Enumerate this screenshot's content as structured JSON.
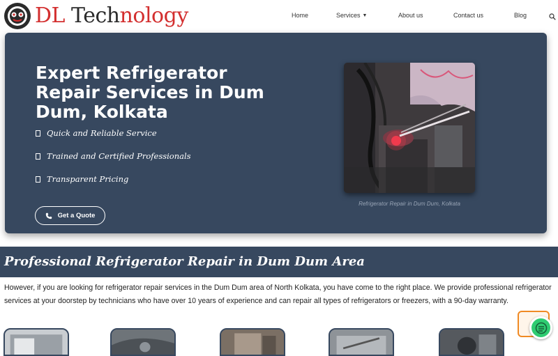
{
  "header": {
    "brand": {
      "part1": "DL",
      "part2": " Tech",
      "part3": "nology"
    },
    "nav": {
      "home": "Home",
      "services": "Services",
      "about": "About us",
      "contact": "Contact us",
      "blog": "Blog"
    },
    "icons": {
      "logo": "logo-emblem",
      "services_dropdown": "chevron-down-icon",
      "search": "search-icon"
    }
  },
  "hero": {
    "title": "Expert Refrigerator Repair Services in Dum Dum, Kolkata",
    "features": [
      "Quick and Reliable Service",
      "Trained and Certified Professionals",
      "Transparent Pricing"
    ],
    "cta_label": "Get a Quote",
    "cta_icon": "phone-icon",
    "image_caption": "Refrigerator Repair in Dum Dum, Kolkata"
  },
  "section": {
    "title": "Professional Refrigerator Repair in Dum Dum Area",
    "intro": "However, if you are looking for refrigerator repair services in the Dum Dum area of North Kolkata, you have come to the right place. We provide professional refrigerator services at your doorstep by technicians who have over 10 years of experience and can repair all types of refrigerators or freezers, with a 90-day warranty."
  },
  "widgets": {
    "chat_icon": "chat-icon"
  },
  "colors": {
    "brand_red": "#d32f2f",
    "hero_bg": "#37485f",
    "widget_green": "#2ecc71",
    "widget_orange": "#f08a24"
  }
}
